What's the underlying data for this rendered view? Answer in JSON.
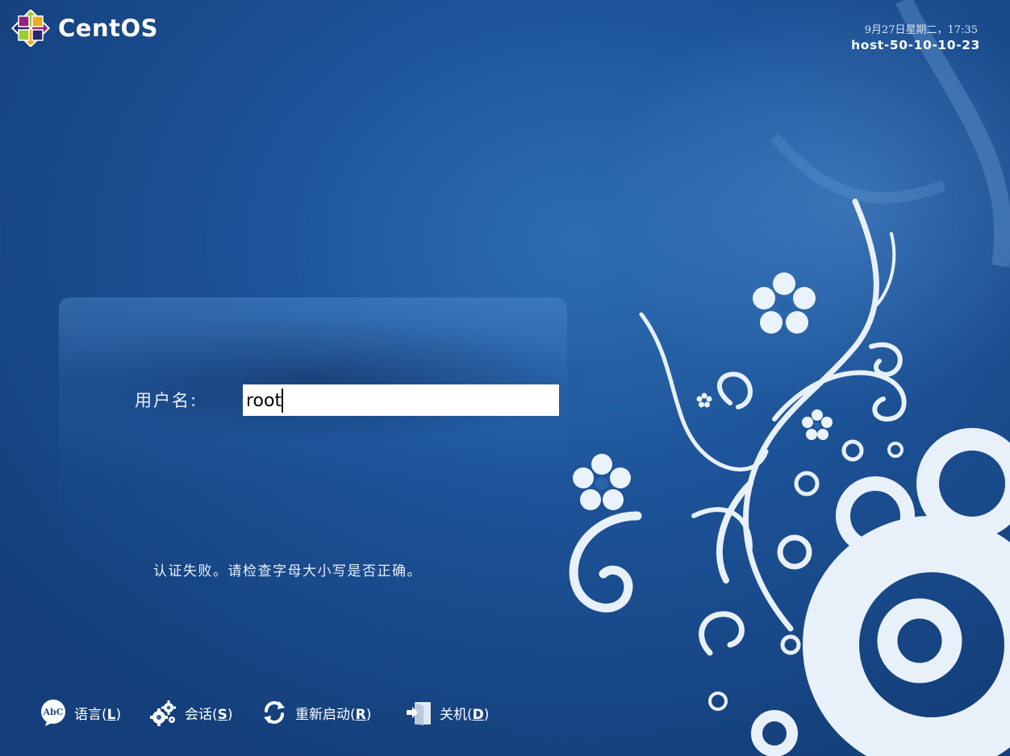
{
  "header": {
    "brand": "CentOS",
    "clock": "9月27日星期二，17:35",
    "hostname": "host-50-10-10-23"
  },
  "login": {
    "username_label": "用户名:",
    "username_value": "root",
    "error_message": "认证失败。请检查字母大小写是否正确。"
  },
  "toolbar": {
    "items": [
      {
        "label": "语言",
        "key": "L",
        "icon": "language-icon"
      },
      {
        "label": "会话",
        "key": "S",
        "icon": "session-gears-icon"
      },
      {
        "label": "重新启动",
        "key": "R",
        "icon": "restart-icon"
      },
      {
        "label": "关机",
        "key": "D",
        "icon": "shutdown-icon"
      }
    ]
  },
  "colors": {
    "background": "#1d5398",
    "panel": "#3a78bd",
    "text": "#ffffff"
  }
}
